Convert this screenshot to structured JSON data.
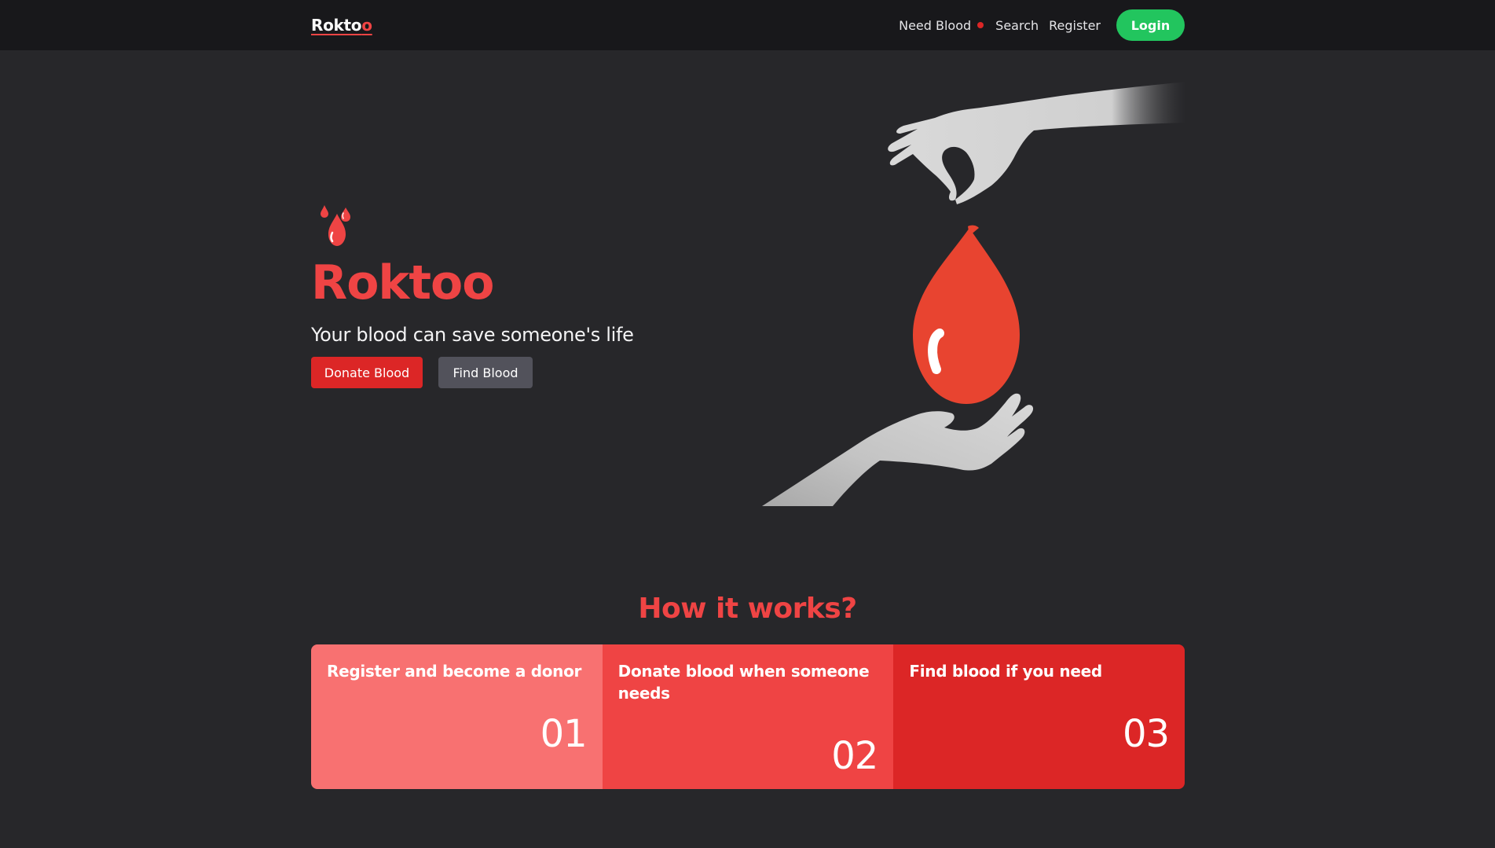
{
  "navbar": {
    "logo_main": "Rokto",
    "logo_accent": "o",
    "links": [
      {
        "label": "Need Blood",
        "has_dot": true
      },
      {
        "label": "Search"
      },
      {
        "label": "Register"
      }
    ],
    "login_label": "Login"
  },
  "hero": {
    "icon": "blood-drops-icon",
    "title": "Roktoo",
    "subtitle": "Your blood can save someone's life",
    "donate_button": "Donate Blood",
    "find_button": "Find Blood",
    "illustration": "hands-with-blood-drop-illustration"
  },
  "how_it_works": {
    "title": "How it works?",
    "steps": [
      {
        "title": "Register and become a donor",
        "number": "01"
      },
      {
        "title": "Donate blood when someone needs",
        "number": "02"
      },
      {
        "title": "Find blood if you need",
        "number": "03"
      }
    ]
  },
  "colors": {
    "background": "#27272a",
    "navbar": "#18181b",
    "accent_red": "#ef4444",
    "button_red": "#dc2626",
    "button_gray": "#52525b",
    "login_green": "#22c55e",
    "step_1": "#f87171",
    "step_2": "#ef4444",
    "step_3": "#dc2626"
  }
}
